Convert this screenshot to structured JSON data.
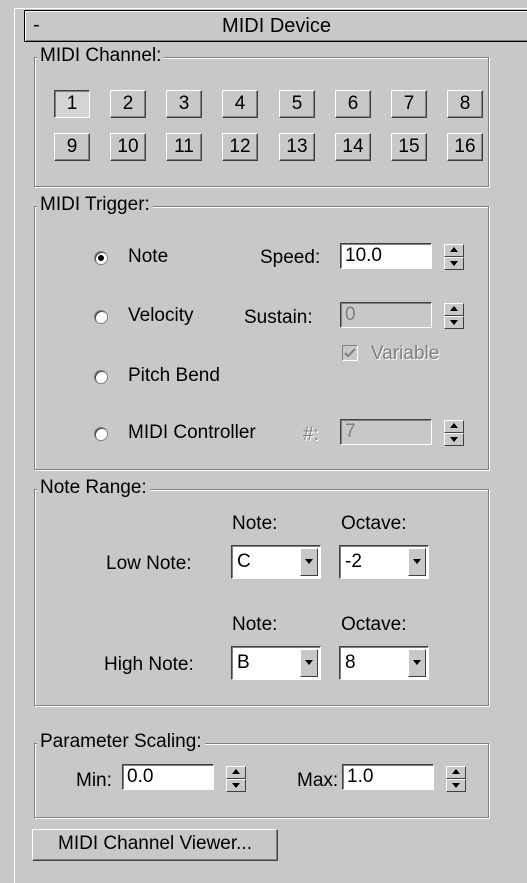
{
  "rollout": {
    "collapse_symbol": "-",
    "title": "MIDI Device"
  },
  "midi_channel": {
    "label": "MIDI Channel:",
    "channels": [
      "1",
      "2",
      "3",
      "4",
      "5",
      "6",
      "7",
      "8",
      "9",
      "10",
      "11",
      "12",
      "13",
      "14",
      "15",
      "16"
    ],
    "selected": "1"
  },
  "midi_trigger": {
    "label": "MIDI Trigger:",
    "options": [
      "Note",
      "Velocity",
      "Pitch Bend",
      "MIDI Controller"
    ],
    "selected": "Note",
    "speed_label": "Speed:",
    "speed_value": "10.0",
    "sustain_label": "Sustain:",
    "sustain_value": "0",
    "variable_label": "Variable",
    "variable_checked": true,
    "controller_label": "#:",
    "controller_value": "7"
  },
  "note_range": {
    "label": "Note Range:",
    "note_header": "Note:",
    "octave_header": "Octave:",
    "low_label": "Low Note:",
    "low_note": "C",
    "low_octave": "-2",
    "high_label": "High Note:",
    "high_note": "B",
    "high_octave": "8"
  },
  "parameter_scaling": {
    "label": "Parameter Scaling:",
    "min_label": "Min:",
    "min_value": "0.0",
    "max_label": "Max:",
    "max_value": "1.0"
  },
  "viewer_button": "MIDI Channel Viewer..."
}
